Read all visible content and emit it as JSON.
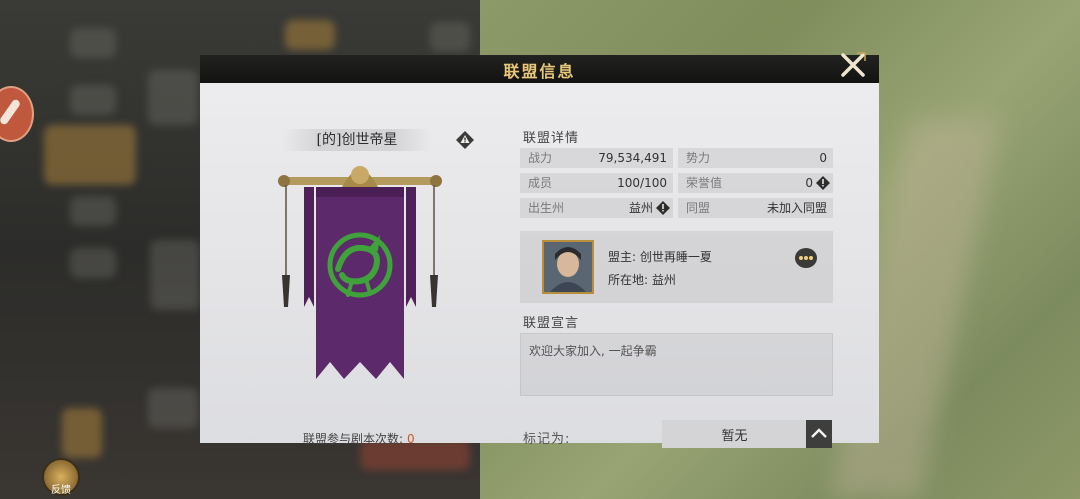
{
  "dialog": {
    "title": "联盟信息"
  },
  "guild": {
    "name": "[的]创世帝星",
    "scenario_count_label": "联盟参与剧本次数:",
    "scenario_count": "0"
  },
  "details": {
    "heading": "联盟详情",
    "stats": [
      {
        "label": "战力",
        "value": "79,534,491"
      },
      {
        "label": "势力",
        "value": "0"
      },
      {
        "label": "成员",
        "value": "100/100"
      },
      {
        "label": "荣誉值",
        "value": "0"
      },
      {
        "label": "出生州",
        "value": "益州"
      },
      {
        "label": "同盟",
        "value": "未加入同盟"
      }
    ]
  },
  "leader": {
    "name_line": "盟主: 创世再睡一夏",
    "location_line": "所在地: 益州"
  },
  "declaration": {
    "heading": "联盟宣言",
    "text": "欢迎大家加入, 一起争霸"
  },
  "mark": {
    "label": "标记为:",
    "value": "暂无"
  },
  "hud": {
    "bottom_badge": "反馈"
  },
  "colors": {
    "title_gold": "#e8c77a",
    "banner_purple": "#5c2a6a",
    "dragon_green": "#3fa23a",
    "count_orange": "#d0572c"
  },
  "icons": [
    "close-icon",
    "warning-icon",
    "more-icon",
    "chevron-up-icon"
  ]
}
